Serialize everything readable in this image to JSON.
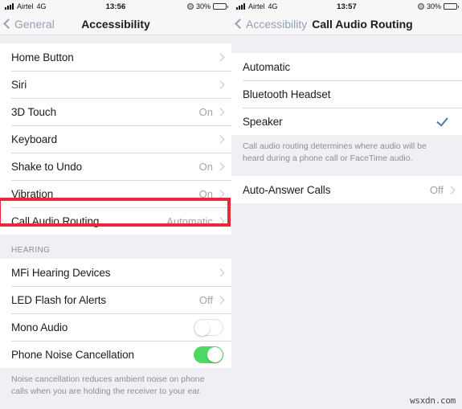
{
  "left": {
    "statusbar": {
      "carrier": "Airtel",
      "network": "4G",
      "time": "13:56",
      "battery_percent": "30%",
      "signal_icon": "signal-bars-icon",
      "alarm_icon": "alarm-clock-icon",
      "battery_icon": "battery-icon"
    },
    "nav": {
      "back_label": "General",
      "title": "Accessibility",
      "back_icon": "chevron-left-icon"
    },
    "interaction_group": [
      {
        "label": "Home Button",
        "value": "",
        "accessory": "chevron-right-icon"
      },
      {
        "label": "Siri",
        "value": "",
        "accessory": "chevron-right-icon"
      },
      {
        "label": "3D Touch",
        "value": "On",
        "accessory": "chevron-right-icon"
      },
      {
        "label": "Keyboard",
        "value": "",
        "accessory": "chevron-right-icon"
      },
      {
        "label": "Shake to Undo",
        "value": "On",
        "accessory": "chevron-right-icon"
      },
      {
        "label": "Vibration",
        "value": "On",
        "accessory": "chevron-right-icon"
      },
      {
        "label": "Call Audio Routing",
        "value": "Automatic",
        "accessory": "chevron-right-icon"
      }
    ],
    "hearing_header": "HEARING",
    "hearing_group": [
      {
        "label": "MFi Hearing Devices",
        "value": "",
        "accessory": "chevron-right-icon"
      },
      {
        "label": "LED Flash for Alerts",
        "value": "Off",
        "accessory": "chevron-right-icon"
      },
      {
        "label": "Mono Audio",
        "value": "",
        "accessory": "switch-off"
      },
      {
        "label": "Phone Noise Cancellation",
        "value": "",
        "accessory": "switch-on"
      }
    ],
    "footer": "Noise cancellation reduces ambient noise on phone calls when you are holding the receiver to your ear.",
    "highlight_color": "#e8293b"
  },
  "right": {
    "statusbar": {
      "carrier": "Airtel",
      "network": "4G",
      "time": "13:57",
      "battery_percent": "30%",
      "signal_icon": "signal-bars-icon",
      "alarm_icon": "alarm-clock-icon",
      "battery_icon": "battery-icon"
    },
    "nav": {
      "back_label": "Accessibility",
      "title": "Call Audio Routing",
      "back_icon": "chevron-left-icon"
    },
    "routing_options": [
      {
        "label": "Automatic",
        "selected": false
      },
      {
        "label": "Bluetooth Headset",
        "selected": false
      },
      {
        "label": "Speaker",
        "selected": true
      }
    ],
    "routing_footer": "Call audio routing determines where audio will be heard during a phone call or FaceTime audio.",
    "auto_answer": {
      "label": "Auto-Answer Calls",
      "value": "Off",
      "accessory": "chevron-right-icon"
    },
    "check_color": "#4a7cb0"
  },
  "watermark": "wsxdn.com"
}
